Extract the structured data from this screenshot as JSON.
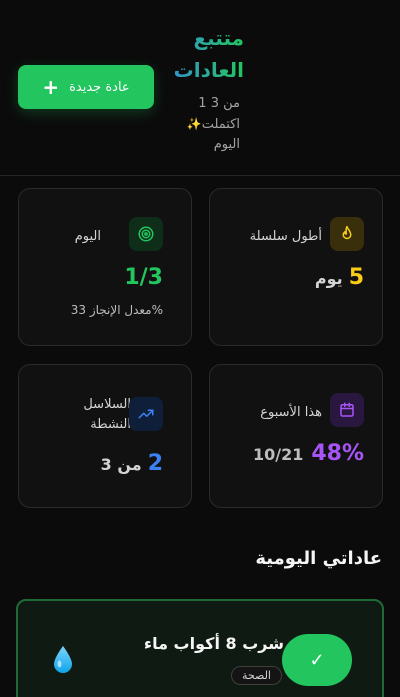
{
  "header": {
    "title_line1": "متتبع",
    "title_line2": "العادات",
    "subtitle_line1": "من 3 1",
    "subtitle_line2": "اكتملت",
    "subtitle_line3": "اليوم",
    "add_button_label": "عادة جديدة",
    "add_button_icon": "+"
  },
  "stats": {
    "longest_streak": {
      "label": "أطول سلسلة",
      "value": "5",
      "unit": "يوم",
      "icon": "flame-icon",
      "color": "#facc15"
    },
    "today": {
      "label": "اليوم",
      "value": "1/3",
      "caption": "%معدل الإنجاز 33",
      "icon": "target-icon",
      "color": "#22c55e"
    },
    "this_week": {
      "label": "هذا الأسبوع",
      "percent": "48%",
      "ratio": "10/21",
      "icon": "calendar-icon",
      "color": "#a855f7"
    },
    "active_streaks": {
      "label_line1": "السلاسل",
      "label_line2": "النشطة",
      "value": "2",
      "unit": "من 3",
      "icon": "trending-up-icon",
      "color": "#3b82f6"
    }
  },
  "section": {
    "title": "عاداتي اليومية"
  },
  "habits": [
    {
      "name": "شرب 8 أكواب ماء",
      "category": "الصحة",
      "completed": true,
      "icon": "water-drop-icon",
      "check_icon": "✓"
    }
  ]
}
